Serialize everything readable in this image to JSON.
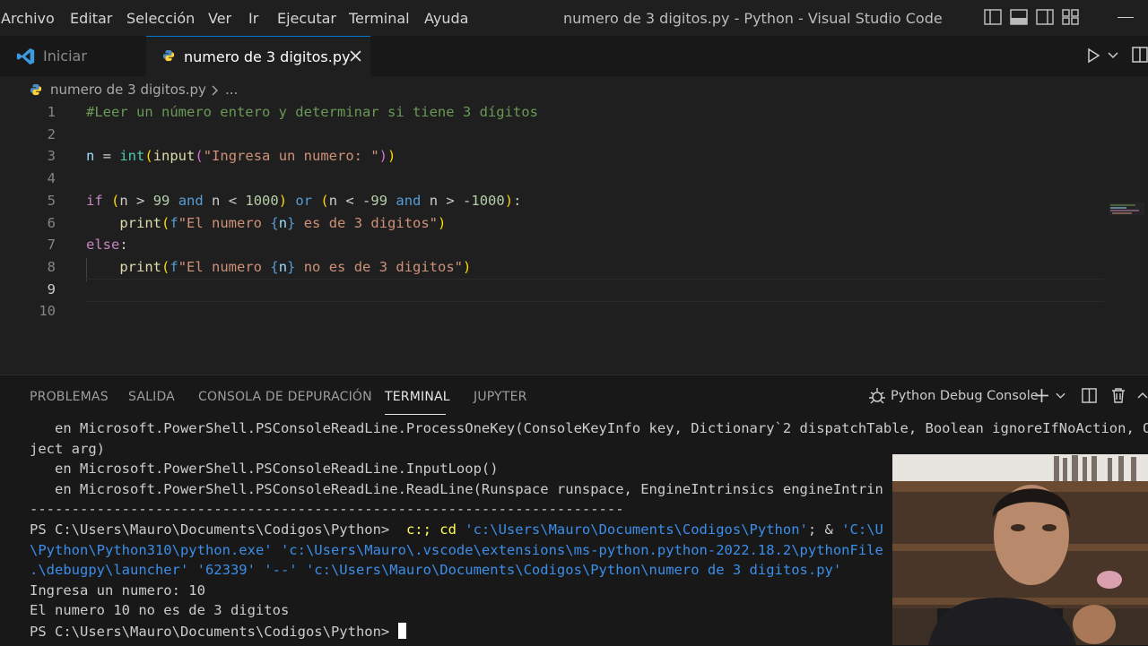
{
  "menu": [
    "Archivo",
    "Editar",
    "Selección",
    "Ver",
    "Ir",
    "Ejecutar",
    "Terminal",
    "Ayuda"
  ],
  "window_title": "numero de 3 digitos.py - Python - Visual Studio Code",
  "tabs": {
    "welcome": "Iniciar",
    "file": "numero de 3 digitos.py"
  },
  "breadcrumb": {
    "file": "numero de 3 digitos.py",
    "more": "..."
  },
  "editor": {
    "line_numbers": [
      "1",
      "2",
      "3",
      "4",
      "5",
      "6",
      "7",
      "8",
      "9",
      "10"
    ],
    "l1": "#Leer un número entero y determinar si tiene 3 dígitos",
    "l3": {
      "n": "n",
      "eq": " = ",
      "int": "int",
      "p1": "(",
      "input": "input",
      "p2": "(",
      "s": "\"Ingresa un numero: \"",
      "p3": ")",
      "p4": ")"
    },
    "l5": {
      "if": "if",
      "sp": " ",
      "p1": "(",
      "a": "n > ",
      "n99": "99",
      "and1": " and ",
      "b": "n < ",
      "n1000": "1000",
      "p2": ")",
      "or": " or ",
      "p3": "(",
      "c": "n < -",
      "n99b": "99",
      "and2": " and ",
      "d": "n > -",
      "n1000b": "1000",
      "p4": ")",
      "colon": ":"
    },
    "l6": {
      "indent": "    ",
      "print": "print",
      "p1": "(",
      "f": "f",
      "s1": "\"El numero ",
      "b1": "{",
      "n": "n",
      "b2": "}",
      "s2": " es de 3 digitos\"",
      "p2": ")"
    },
    "l7": {
      "else": "else",
      "colon": ":"
    },
    "l8": {
      "indent": "    ",
      "print": "print",
      "p1": "(",
      "f": "f",
      "s1": "\"El numero ",
      "b1": "{",
      "n": "n",
      "b2": "}",
      "s2": " no es de 3 digitos\"",
      "p2": ")"
    }
  },
  "panel": {
    "tabs": [
      "PROBLEMAS",
      "SALIDA",
      "CONSOLA DE DEPURACIÓN",
      "TERMINAL",
      "JUPYTER"
    ],
    "active_tab": "TERMINAL",
    "debug_console": "Python Debug Console"
  },
  "terminal": {
    "l1": "   en Microsoft.PowerShell.PSConsoleReadLine.ProcessOneKey(ConsoleKeyInfo key, Dictionary`2 dispatchTable, Boolean ignoreIfNoAction, Ob",
    "l2": "ject arg)",
    "l3": "   en Microsoft.PowerShell.PSConsoleReadLine.InputLoop()",
    "l4": "   en Microsoft.PowerShell.PSConsoleReadLine.ReadLine(Runspace runspace, EngineIntrinsics engineIntrin",
    "l5": "-----------------------------------------------------------------------",
    "l6_prompt": "PS C:\\Users\\Mauro\\Documents\\Codigos\\Python> ",
    "l6_cmd": " c:; cd ",
    "l6_str": "'c:\\Users\\Mauro\\Documents\\Codigos\\Python'",
    "l6_rest": "; & ",
    "l6_str2": "'C:\\U",
    "l7": "\\Python\\Python310\\python.exe' 'c:\\Users\\Mauro\\.vscode\\extensions\\ms-python.python-2022.18.2\\pythonFile",
    "l8": ".\\debugpy\\launcher' '62339' '--' 'c:\\Users\\Mauro\\Documents\\Codigos\\Python\\numero de 3 digitos.py'",
    "l9": "Ingresa un numero: 10",
    "l10": "El numero 10 no es de 3 digitos",
    "l11": "PS C:\\Users\\Mauro\\Documents\\Codigos\\Python> "
  },
  "colors": {
    "accent": "#0078d4",
    "comment": "#6a9955",
    "keyword": "#569cd6",
    "control": "#c586c0",
    "function": "#dcdcaa",
    "string": "#ce9178",
    "number": "#b5cea8",
    "variable": "#9cdcfe"
  },
  "icons": [
    "vscode-logo-icon",
    "python-file-icon",
    "close-icon",
    "run-icon",
    "chevron-down-icon",
    "split-editor-icon",
    "layout-icons",
    "debug-icon",
    "plus-icon",
    "split-terminal-icon",
    "trash-icon",
    "chevron-up-icon"
  ]
}
